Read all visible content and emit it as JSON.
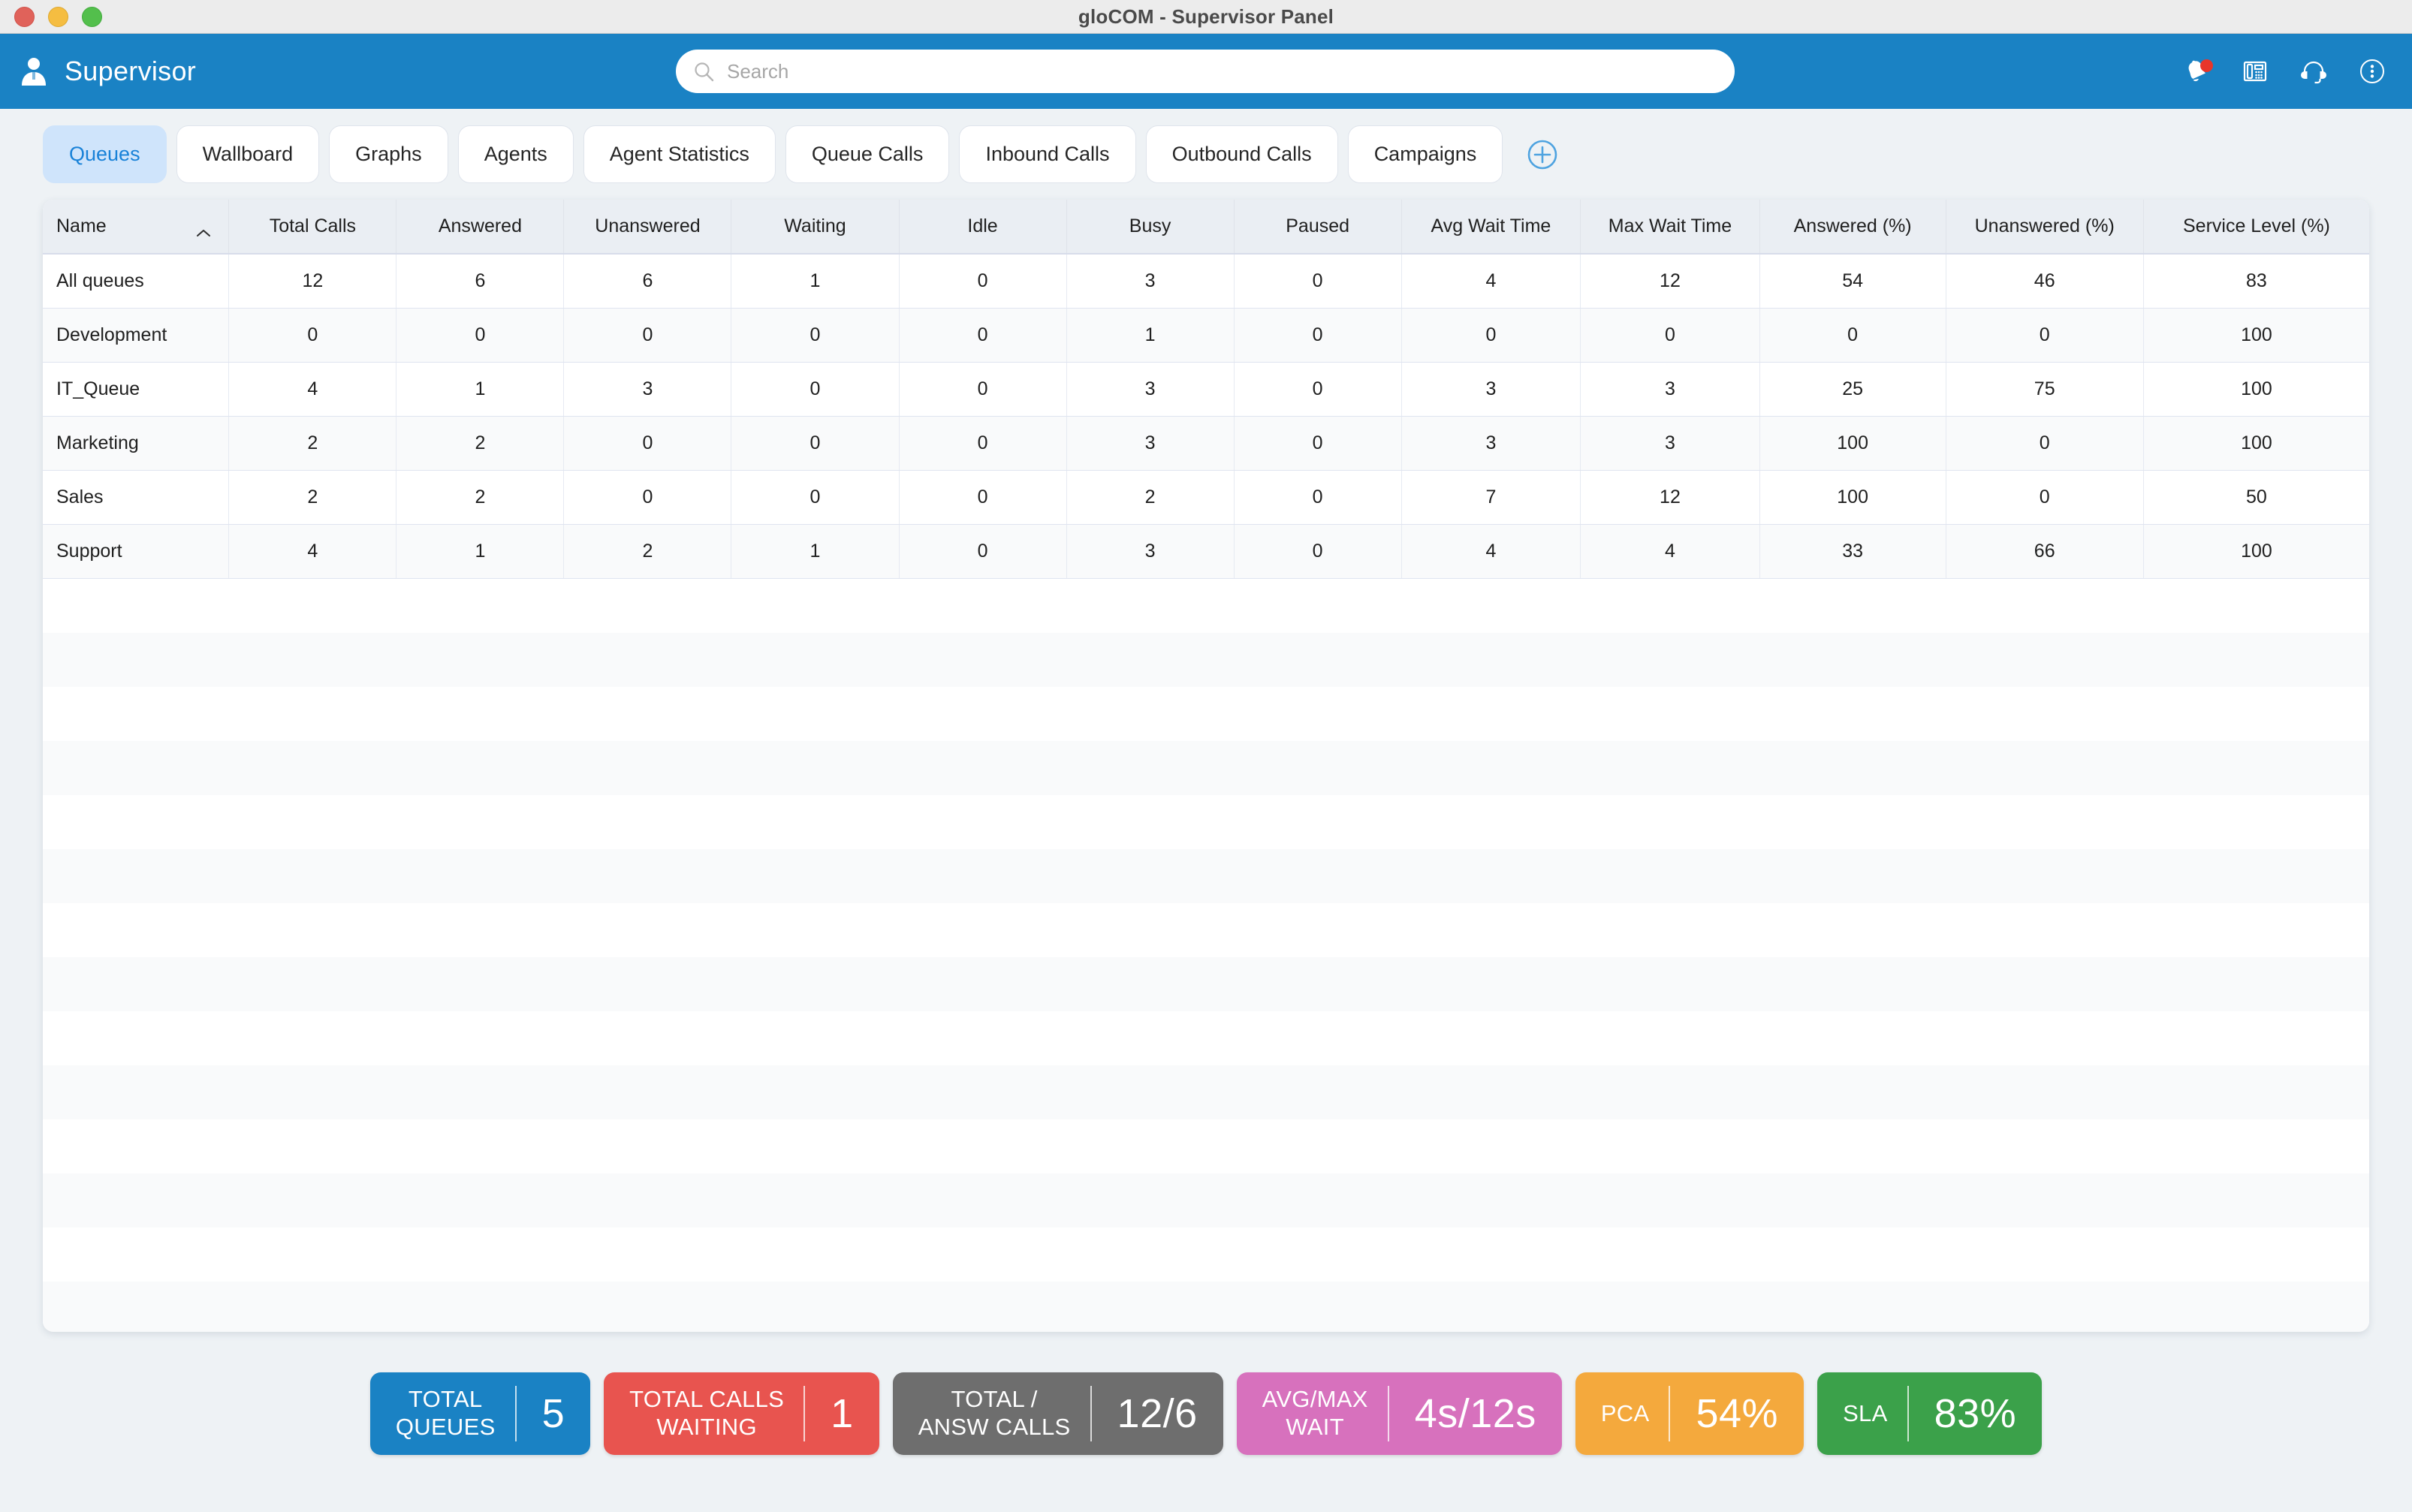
{
  "window": {
    "title": "gloCOM - Supervisor Panel",
    "traffic_lights": [
      "close-red",
      "minimize-yellow",
      "zoom-green"
    ]
  },
  "header": {
    "app_title": "Supervisor",
    "user_icon": "supervisor-avatar-icon",
    "search": {
      "value": "",
      "placeholder": "Search",
      "icon": "search-icon"
    },
    "icons": [
      {
        "name": "notification-bell-icon",
        "has_badge": true
      },
      {
        "name": "desk-phone-icon",
        "has_badge": false
      },
      {
        "name": "headset-icon",
        "has_badge": false
      },
      {
        "name": "more-options-icon",
        "has_badge": false
      }
    ],
    "accent_color": "#1a82c4"
  },
  "tabs": {
    "items": [
      {
        "label": "Queues",
        "active": true
      },
      {
        "label": "Wallboard",
        "active": false
      },
      {
        "label": "Graphs",
        "active": false
      },
      {
        "label": "Agents",
        "active": false
      },
      {
        "label": "Agent Statistics",
        "active": false
      },
      {
        "label": "Queue Calls",
        "active": false
      },
      {
        "label": "Inbound Calls",
        "active": false
      },
      {
        "label": "Outbound Calls",
        "active": false
      },
      {
        "label": "Campaigns",
        "active": false
      }
    ],
    "add_tab_icon": "add-circle-icon",
    "active_bg": "#cfe4fb",
    "active_fg": "#1982d8"
  },
  "table": {
    "sort_column": "Name",
    "sort_direction": "ascending",
    "columns": [
      "Name",
      "Total Calls",
      "Answered",
      "Unanswered",
      "Waiting",
      "Idle",
      "Busy",
      "Paused",
      "Avg Wait Time",
      "Max Wait Time",
      "Answered (%)",
      "Unanswered (%)",
      "Service Level (%)"
    ],
    "rows": [
      {
        "cells": [
          "All queues",
          "12",
          "6",
          "6",
          "1",
          "0",
          "3",
          "0",
          "4",
          "12",
          "54",
          "46",
          "83"
        ]
      },
      {
        "cells": [
          "Development",
          "0",
          "0",
          "0",
          "0",
          "0",
          "1",
          "0",
          "0",
          "0",
          "0",
          "0",
          "100"
        ]
      },
      {
        "cells": [
          "IT_Queue",
          "4",
          "1",
          "3",
          "0",
          "0",
          "3",
          "0",
          "3",
          "3",
          "25",
          "75",
          "100"
        ]
      },
      {
        "cells": [
          "Marketing",
          "2",
          "2",
          "0",
          "0",
          "0",
          "3",
          "0",
          "3",
          "3",
          "100",
          "0",
          "100"
        ]
      },
      {
        "cells": [
          "Sales",
          "2",
          "2",
          "0",
          "0",
          "0",
          "2",
          "0",
          "7",
          "12",
          "100",
          "0",
          "50"
        ]
      },
      {
        "cells": [
          "Support",
          "4",
          "1",
          "2",
          "1",
          "0",
          "3",
          "0",
          "4",
          "4",
          "33",
          "66",
          "100"
        ]
      }
    ]
  },
  "status_badges": [
    {
      "label": "TOTAL\nQUEUES",
      "value": "5",
      "color": "#1a82c4"
    },
    {
      "label": "TOTAL CALLS\nWAITING",
      "value": "1",
      "color": "#e8544f"
    },
    {
      "label": "TOTAL /\nANSW CALLS",
      "value": "12/6",
      "color": "#6e6e6e"
    },
    {
      "label": "AVG/MAX\nWAIT",
      "value": "4s/12s",
      "color": "#d771bd"
    },
    {
      "label": "PCA",
      "value": "54%",
      "color": "#f4a93d"
    },
    {
      "label": "SLA",
      "value": "83%",
      "color": "#3ba14a"
    }
  ]
}
